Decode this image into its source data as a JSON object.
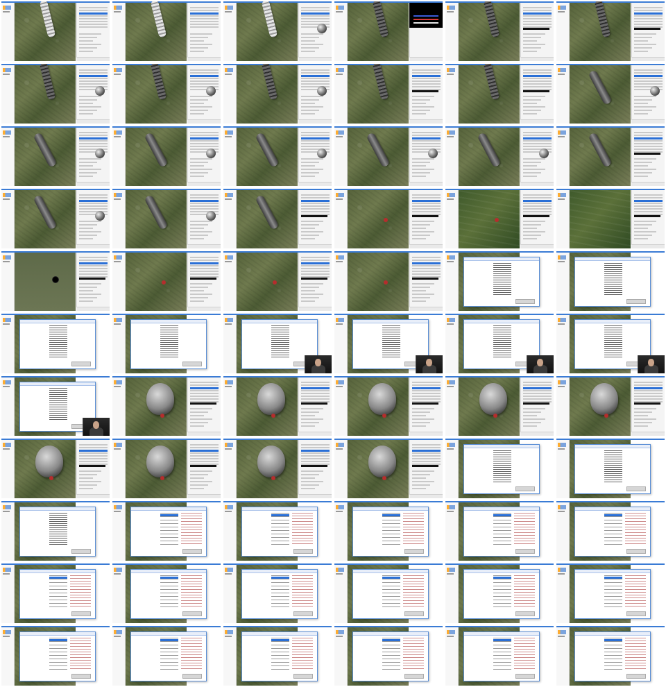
{
  "screen": {
    "frames": [
      {
        "r": 0,
        "c": 0,
        "overlay": "tube",
        "panel": "list"
      },
      {
        "r": 0,
        "c": 1,
        "overlay": "tube",
        "panel": "list"
      },
      {
        "r": 0,
        "c": 2,
        "overlay": "tube",
        "panel": "sphere"
      },
      {
        "r": 0,
        "c": 3,
        "overlay": "tube-dark",
        "panel": "black"
      },
      {
        "r": 0,
        "c": 4,
        "overlay": "tube-dark",
        "panel": "form"
      },
      {
        "r": 0,
        "c": 5,
        "overlay": "tube-dark",
        "panel": "form"
      },
      {
        "r": 1,
        "c": 0,
        "overlay": "tube-dark",
        "panel": "sphere"
      },
      {
        "r": 1,
        "c": 1,
        "overlay": "tube-dark",
        "panel": "sphere"
      },
      {
        "r": 1,
        "c": 2,
        "overlay": "tube-dark",
        "panel": "sphere"
      },
      {
        "r": 1,
        "c": 3,
        "overlay": "tube-dark",
        "panel": "form"
      },
      {
        "r": 1,
        "c": 4,
        "overlay": "tube-dark",
        "panel": "form"
      },
      {
        "r": 1,
        "c": 5,
        "overlay": "curve",
        "panel": "sphere"
      },
      {
        "r": 2,
        "c": 0,
        "overlay": "curve",
        "panel": "sphere"
      },
      {
        "r": 2,
        "c": 1,
        "overlay": "curve",
        "panel": "sphere"
      },
      {
        "r": 2,
        "c": 2,
        "overlay": "curve",
        "panel": "sphere"
      },
      {
        "r": 2,
        "c": 3,
        "overlay": "curve",
        "panel": "sphere"
      },
      {
        "r": 2,
        "c": 4,
        "overlay": "curve",
        "panel": "sphere"
      },
      {
        "r": 2,
        "c": 5,
        "overlay": "curve",
        "panel": "form"
      },
      {
        "r": 3,
        "c": 0,
        "overlay": "curve",
        "panel": "sphere"
      },
      {
        "r": 3,
        "c": 1,
        "overlay": "curve",
        "panel": "sphere"
      },
      {
        "r": 3,
        "c": 2,
        "overlay": "curve",
        "panel": "form"
      },
      {
        "r": 3,
        "c": 3,
        "overlay": "dot",
        "panel": "form"
      },
      {
        "r": 3,
        "c": 4,
        "overlay": "dot",
        "panel": "form",
        "map": "alt"
      },
      {
        "r": 3,
        "c": 5,
        "overlay": "none",
        "panel": "form",
        "map": "alt"
      },
      {
        "r": 4,
        "c": 0,
        "overlay": "hole",
        "panel": "form",
        "map": "flat"
      },
      {
        "r": 4,
        "c": 1,
        "overlay": "dot",
        "panel": "form"
      },
      {
        "r": 4,
        "c": 2,
        "overlay": "dot",
        "panel": "form"
      },
      {
        "r": 4,
        "c": 3,
        "overlay": "dot",
        "panel": "form"
      },
      {
        "r": 4,
        "c": 4,
        "overlay": "dialog-list",
        "panel": "none"
      },
      {
        "r": 4,
        "c": 5,
        "overlay": "dialog-list",
        "panel": "none"
      },
      {
        "r": 5,
        "c": 0,
        "overlay": "dialog-list",
        "panel": "none"
      },
      {
        "r": 5,
        "c": 1,
        "overlay": "dialog-list",
        "panel": "none"
      },
      {
        "r": 5,
        "c": 2,
        "overlay": "dialog-list-webcam",
        "panel": "none"
      },
      {
        "r": 5,
        "c": 3,
        "overlay": "dialog-list-webcam",
        "panel": "none"
      },
      {
        "r": 5,
        "c": 4,
        "overlay": "dialog-list-webcam",
        "panel": "none"
      },
      {
        "r": 5,
        "c": 5,
        "overlay": "dialog-list-webcam",
        "panel": "none"
      },
      {
        "r": 6,
        "c": 0,
        "overlay": "dialog-list-webcam",
        "panel": "none"
      },
      {
        "r": 6,
        "c": 1,
        "overlay": "balloon",
        "panel": "form"
      },
      {
        "r": 6,
        "c": 2,
        "overlay": "balloon",
        "panel": "form"
      },
      {
        "r": 6,
        "c": 3,
        "overlay": "balloon",
        "panel": "form"
      },
      {
        "r": 6,
        "c": 4,
        "overlay": "balloon",
        "panel": "form"
      },
      {
        "r": 6,
        "c": 5,
        "overlay": "balloon",
        "panel": "form"
      },
      {
        "r": 7,
        "c": 0,
        "overlay": "balloon",
        "panel": "form"
      },
      {
        "r": 7,
        "c": 1,
        "overlay": "balloon",
        "panel": "form"
      },
      {
        "r": 7,
        "c": 2,
        "overlay": "balloon",
        "panel": "form"
      },
      {
        "r": 7,
        "c": 3,
        "overlay": "balloon",
        "panel": "form"
      },
      {
        "r": 7,
        "c": 4,
        "overlay": "dialog-list",
        "panel": "none"
      },
      {
        "r": 7,
        "c": 5,
        "overlay": "dialog-list",
        "panel": "none"
      },
      {
        "r": 8,
        "c": 0,
        "overlay": "dialog-list",
        "panel": "none"
      },
      {
        "r": 8,
        "c": 1,
        "overlay": "dialog-tree",
        "panel": "none"
      },
      {
        "r": 8,
        "c": 2,
        "overlay": "dialog-tree",
        "panel": "none"
      },
      {
        "r": 8,
        "c": 3,
        "overlay": "dialog-tree",
        "panel": "none"
      },
      {
        "r": 8,
        "c": 4,
        "overlay": "dialog-tree",
        "panel": "none"
      },
      {
        "r": 8,
        "c": 5,
        "overlay": "dialog-tree",
        "panel": "none"
      },
      {
        "r": 9,
        "c": 0,
        "overlay": "dialog-tree",
        "panel": "none"
      },
      {
        "r": 9,
        "c": 1,
        "overlay": "dialog-tree",
        "panel": "none"
      },
      {
        "r": 9,
        "c": 2,
        "overlay": "dialog-tree",
        "panel": "none"
      },
      {
        "r": 9,
        "c": 3,
        "overlay": "dialog-tree",
        "panel": "none"
      },
      {
        "r": 9,
        "c": 4,
        "overlay": "dialog-tree",
        "panel": "none"
      },
      {
        "r": 9,
        "c": 5,
        "overlay": "dialog-tree",
        "panel": "none"
      },
      {
        "r": 10,
        "c": 0,
        "overlay": "dialog-tree",
        "panel": "none"
      },
      {
        "r": 10,
        "c": 1,
        "overlay": "dialog-tree",
        "panel": "none"
      },
      {
        "r": 10,
        "c": 2,
        "overlay": "dialog-tree",
        "panel": "none"
      },
      {
        "r": 10,
        "c": 3,
        "overlay": "dialog-tree",
        "panel": "none"
      },
      {
        "r": 10,
        "c": 4,
        "overlay": "dialog-tree",
        "panel": "none"
      },
      {
        "r": 10,
        "c": 5,
        "overlay": "dialog-tree",
        "panel": "none"
      }
    ]
  }
}
